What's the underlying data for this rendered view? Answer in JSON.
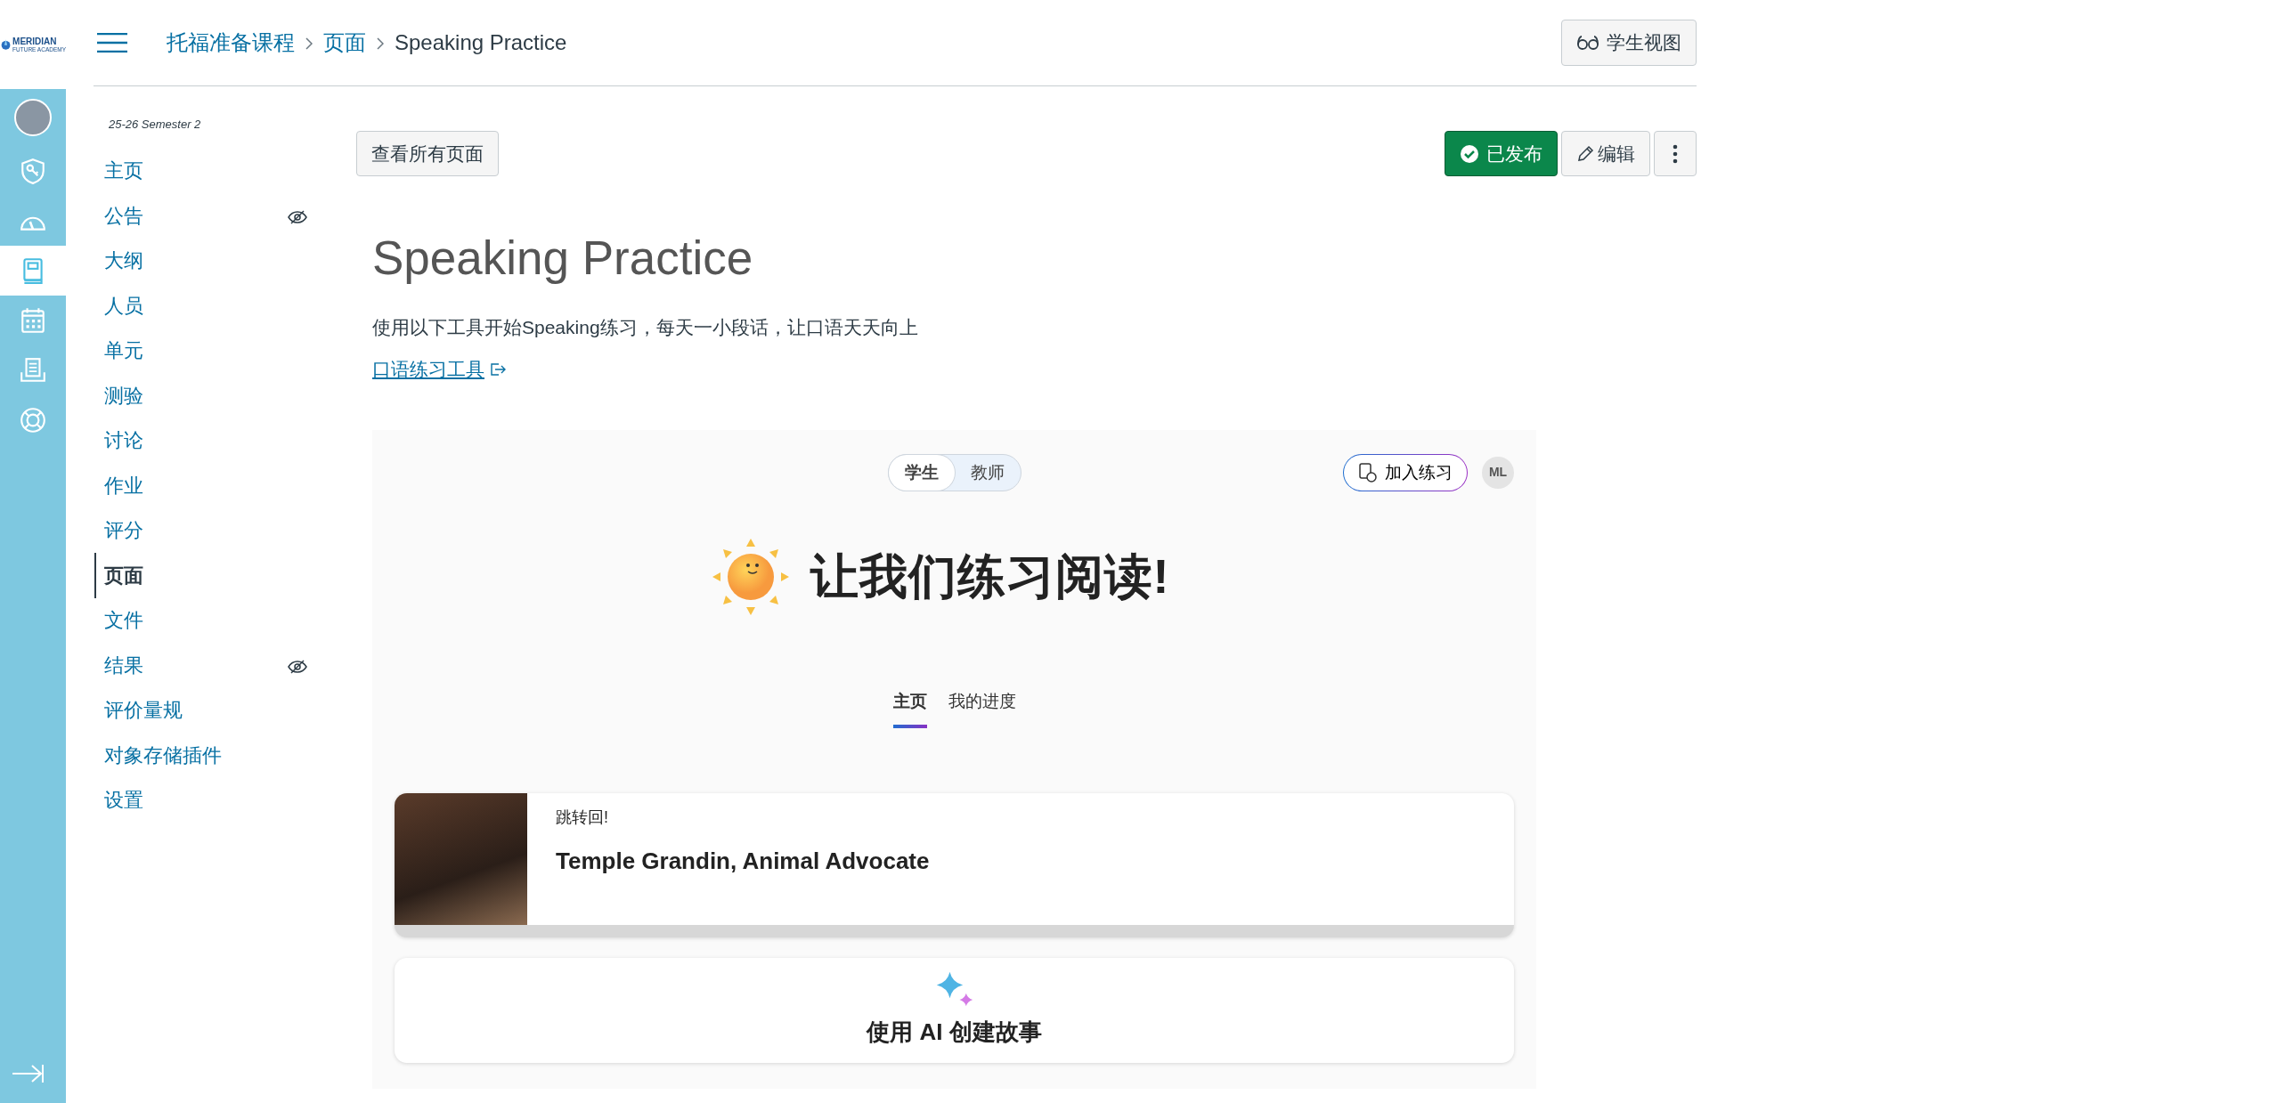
{
  "logo": {
    "name": "MERIDIAN",
    "tagline": "FUTURE ACADEMY"
  },
  "global_nav": [
    {
      "kind": "avatar",
      "selected": false
    },
    {
      "kind": "admin",
      "selected": false
    },
    {
      "kind": "dashboard",
      "selected": false
    },
    {
      "kind": "courses",
      "selected": true
    },
    {
      "kind": "calendar",
      "selected": false
    },
    {
      "kind": "inbox",
      "selected": false
    },
    {
      "kind": "help",
      "selected": false
    }
  ],
  "breadcrumb": [
    {
      "text": "托福准备课程",
      "kind": "link"
    },
    {
      "text": "页面",
      "kind": "link"
    },
    {
      "text": "Speaking Practice",
      "kind": "current"
    }
  ],
  "student_view_button": "学生视图",
  "course_nav": {
    "term": "25-26 Semester 2",
    "items": [
      {
        "label": "主页",
        "selected": false,
        "hidden": false
      },
      {
        "label": "公告",
        "selected": false,
        "hidden": true
      },
      {
        "label": "大纲",
        "selected": false,
        "hidden": false
      },
      {
        "label": "人员",
        "selected": false,
        "hidden": false
      },
      {
        "label": "单元",
        "selected": false,
        "hidden": false
      },
      {
        "label": "测验",
        "selected": false,
        "hidden": false
      },
      {
        "label": "讨论",
        "selected": false,
        "hidden": false
      },
      {
        "label": "作业",
        "selected": false,
        "hidden": false
      },
      {
        "label": "评分",
        "selected": false,
        "hidden": false
      },
      {
        "label": "页面",
        "selected": true,
        "hidden": false
      },
      {
        "label": "文件",
        "selected": false,
        "hidden": false
      },
      {
        "label": "结果",
        "selected": false,
        "hidden": true
      },
      {
        "label": "评价量规",
        "selected": false,
        "hidden": false
      },
      {
        "label": "对象存储插件",
        "selected": false,
        "hidden": false
      },
      {
        "label": "设置",
        "selected": false,
        "hidden": false
      }
    ]
  },
  "toolbar": {
    "all_pages_button": "查看所有页面",
    "publish_button": {
      "label": "已发布",
      "published": true
    },
    "edit_button": "编辑"
  },
  "page": {
    "title": "Speaking Practice",
    "intro": "使用以下工具开始Speaking练习，每天一小段话，让口语天天向上",
    "link": "口语练习工具"
  },
  "embed": {
    "role_toggle": [
      {
        "label": "学生",
        "selected": true
      },
      {
        "label": "教师",
        "selected": false
      }
    ],
    "join_button": "加入练习",
    "avatar_initials": "ML",
    "heading": "让我们练习阅读!",
    "tabs": [
      {
        "label": "主页",
        "selected": true
      },
      {
        "label": "我的进度",
        "selected": false
      }
    ],
    "resume_card": {
      "label": "跳转回!",
      "title": "Temple Grandin, Animal Advocate"
    },
    "create_card": {
      "title": "使用 AI 创建故事"
    }
  }
}
